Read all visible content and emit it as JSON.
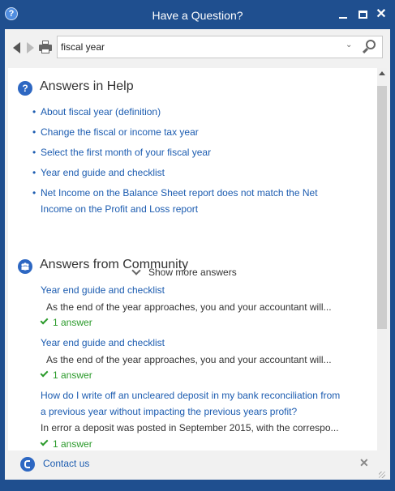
{
  "window": {
    "title": "Have a Question?",
    "app_icon": "?",
    "close_glyph": "✕"
  },
  "toolbar": {
    "search_value": "fiscal year",
    "dropdown_glyph": "⌄"
  },
  "help": {
    "title": "Answers in Help",
    "icon": "?",
    "bullet": "•",
    "items": [
      {
        "line1": "About fiscal year (definition)",
        "line2": ""
      },
      {
        "line1": "Change the fiscal or income tax year",
        "line2": ""
      },
      {
        "line1": "Select the first month of your fiscal year",
        "line2": ""
      },
      {
        "line1": "Year end guide and checklist",
        "line2": ""
      },
      {
        "line1": "Net Income on the Balance Sheet report does not match the Net",
        "line2": "Income on the Profit and Loss report"
      }
    ],
    "show_more": "Show more answers"
  },
  "community": {
    "title": "Answers from Community",
    "icon": "people-icon",
    "items": [
      {
        "q1": "Year end guide and checklist",
        "q2": "",
        "snippet": "As the end of the year approaches, you and your accountant will...",
        "answers": "1 answer"
      },
      {
        "q1": "Year end guide and checklist",
        "q2": "",
        "snippet": "As the end of the year approaches, you and your accountant will...",
        "answers": "1 answer"
      },
      {
        "q1": "How do I write off an uncleared deposit in my bank reconciliation from",
        "q2": "a previous year without impacting the previous years profit?",
        "snippet": "In error a deposit was posted in September 2015, with the correspo...",
        "answers": "1 answer"
      }
    ]
  },
  "footer": {
    "contact": "Contact us",
    "close_glyph": "✕"
  },
  "colors": {
    "titlebar": "#1f4f8f",
    "link": "#1c5cb0",
    "answer_green": "#2a9a2a",
    "icon_blue": "#2d67c2"
  }
}
